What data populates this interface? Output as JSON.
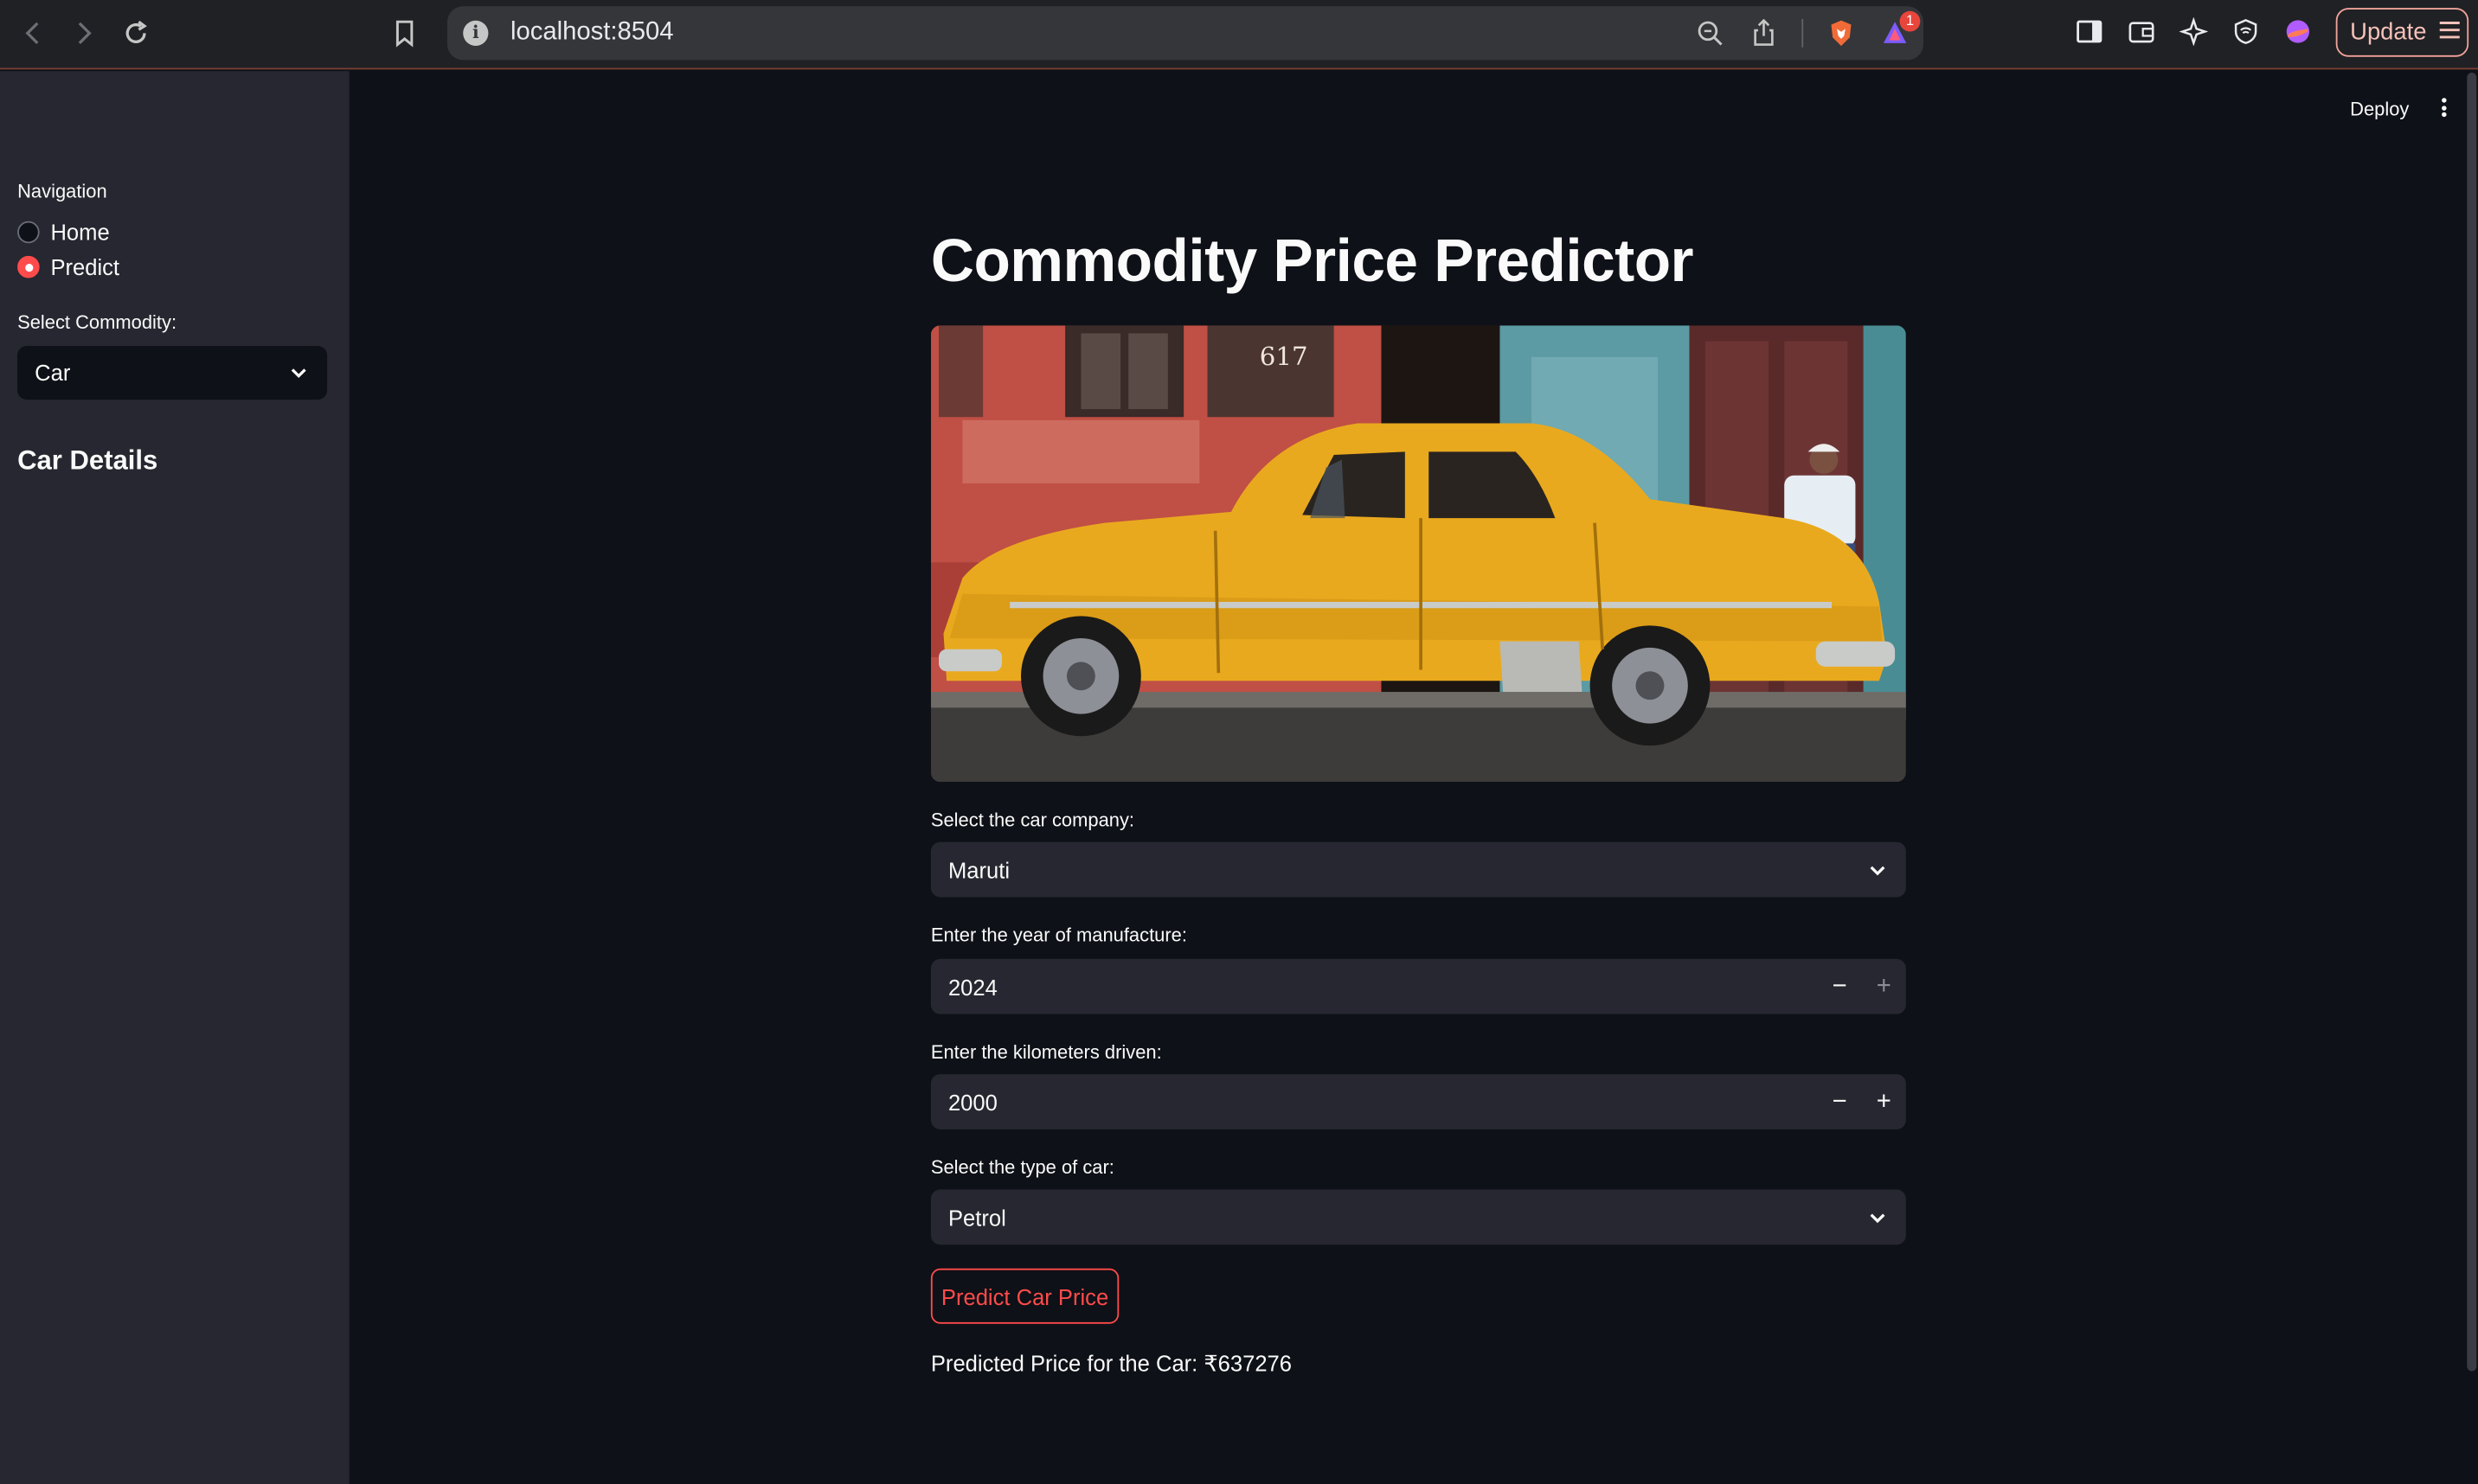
{
  "browser": {
    "url": "localhost:8504",
    "update_label": "Update",
    "notification_count": "1"
  },
  "sidebar": {
    "nav_label": "Navigation",
    "nav_options": [
      {
        "label": "Home",
        "selected": false
      },
      {
        "label": "Predict",
        "selected": true
      }
    ],
    "commodity_label": "Select Commodity:",
    "commodity_value": "Car",
    "section_heading": "Car Details"
  },
  "header": {
    "deploy_label": "Deploy"
  },
  "main": {
    "title": "Commodity Price Predictor",
    "company_label": "Select the car company:",
    "company_value": "Maruti",
    "year_label": "Enter the year of manufacture:",
    "year_value": "2024",
    "km_label": "Enter the kilometers driven:",
    "km_value": "2000",
    "type_label": "Select the type of car:",
    "type_value": "Petrol",
    "predict_button": "Predict Car Price",
    "result_text": "Predicted Price for the Car: ₹637276",
    "image_sign_text": "617"
  },
  "colors": {
    "accent": "#ff4b4b",
    "background": "#0e1117",
    "sidebar": "#262730",
    "car_yellow": "#e9a91e"
  }
}
